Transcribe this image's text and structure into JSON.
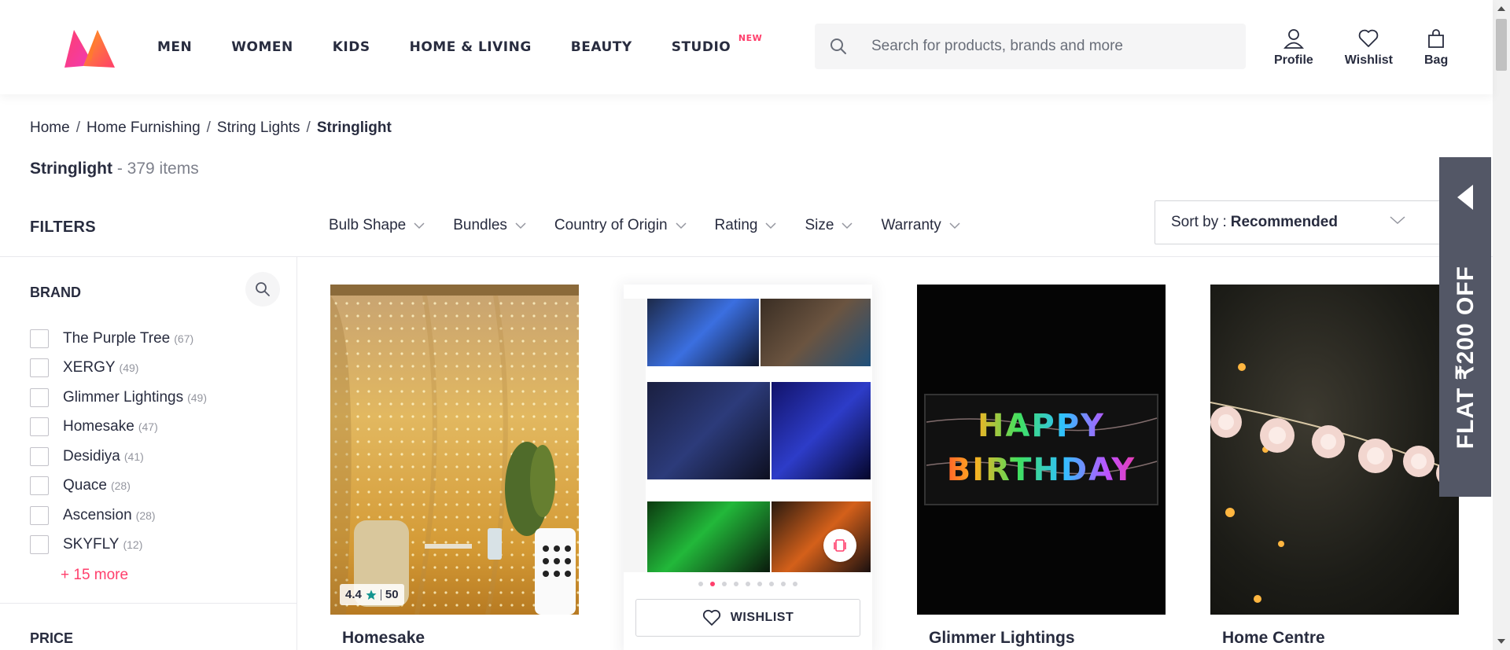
{
  "header": {
    "nav": [
      {
        "label": "MEN"
      },
      {
        "label": "WOMEN"
      },
      {
        "label": "KIDS"
      },
      {
        "label": "HOME & LIVING"
      },
      {
        "label": "BEAUTY"
      },
      {
        "label": "STUDIO",
        "badge": "NEW"
      }
    ],
    "search_placeholder": "Search for products, brands and more",
    "actions": {
      "profile": "Profile",
      "wishlist": "Wishlist",
      "bag": "Bag"
    }
  },
  "breadcrumb": [
    "Home",
    "Home Furnishing",
    "String Lights",
    "Stringlight"
  ],
  "page": {
    "title": "Stringlight",
    "count": "- 379 items"
  },
  "filters": {
    "label": "FILTERS",
    "chips": [
      "Bulb Shape",
      "Bundles",
      "Country of Origin",
      "Rating",
      "Size",
      "Warranty"
    ]
  },
  "sort": {
    "prefix": "Sort by :",
    "value": "Recommended"
  },
  "sidebar": {
    "brand_heading": "BRAND",
    "brands": [
      {
        "name": "The Purple Tree",
        "count": "(67)"
      },
      {
        "name": "XERGY",
        "count": "(49)"
      },
      {
        "name": "Glimmer Lightings",
        "count": "(49)"
      },
      {
        "name": "Homesake",
        "count": "(47)"
      },
      {
        "name": "Desidiya",
        "count": "(41)"
      },
      {
        "name": "Quace",
        "count": "(28)"
      },
      {
        "name": "Ascension",
        "count": "(28)"
      },
      {
        "name": "SKYFLY",
        "count": "(12)"
      }
    ],
    "more": "+ 15 more",
    "price_heading": "PRICE"
  },
  "products": [
    {
      "brand": "Homesake",
      "rating": "4.4",
      "rating_count": "50"
    },
    {
      "brand": "",
      "wishlist_label": "WISHLIST",
      "image_count": 9,
      "active_image": 2
    },
    {
      "brand": "Glimmer Lightings",
      "image_text": "HAPPY BIRTHDAY"
    },
    {
      "brand": "Home Centre"
    }
  ],
  "promo": {
    "text": "FLAT ₹200 OFF"
  },
  "colors": {
    "accent": "#ff3f6c",
    "text": "#282c3f",
    "muted": "#7e818c",
    "promo_bg": "#535766",
    "star": "#14958f"
  }
}
